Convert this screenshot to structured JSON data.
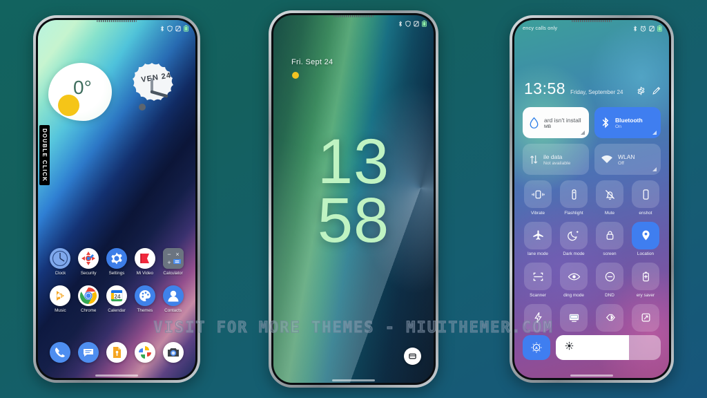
{
  "watermark": {
    "text": "VISIT FOR MORE THEMES - MIUITHEMER.COM"
  },
  "phone1": {
    "badge": "DOUBLE CLICK",
    "statusbar": {
      "icons": [
        "bluetooth-icon",
        "shield-icon",
        "mute-icon",
        "battery-icon"
      ]
    },
    "weather_widget": {
      "temperature": "0°"
    },
    "clock_widget": {
      "label": "VEN 24"
    },
    "apps": [
      {
        "label": "Clock",
        "icon": "clock-icon"
      },
      {
        "label": "Security",
        "icon": "security-icon"
      },
      {
        "label": "Settings",
        "icon": "gear-icon"
      },
      {
        "label": "Mi Video",
        "icon": "video-icon"
      },
      {
        "label": "Calculator",
        "icon": "calculator-icon"
      },
      {
        "label": "Music",
        "icon": "music-icon"
      },
      {
        "label": "Chrome",
        "icon": "chrome-icon"
      },
      {
        "label": "Calendar",
        "icon": "calendar-icon"
      },
      {
        "label": "Themes",
        "icon": "themes-icon"
      },
      {
        "label": "Contacts",
        "icon": "contacts-icon"
      }
    ],
    "dock": [
      {
        "label": "Phone",
        "icon": "phone-icon"
      },
      {
        "label": "Messages",
        "icon": "messages-icon"
      },
      {
        "label": "Files",
        "icon": "files-icon"
      },
      {
        "label": "Photos",
        "icon": "photos-icon"
      },
      {
        "label": "Camera",
        "icon": "camera-icon"
      }
    ]
  },
  "phone2": {
    "statusbar": {
      "icons": [
        "bluetooth-icon",
        "shield-icon",
        "mute-icon",
        "battery-icon"
      ]
    },
    "date": "Fri. Sept  24",
    "clock_hours": "13",
    "clock_minutes": "58",
    "clock_color": "#bff3c2",
    "wallet_button": "wallet-icon"
  },
  "phone3": {
    "carrier": "ency calls only",
    "statusbar": {
      "icons": [
        "bluetooth-icon",
        "alarm-icon",
        "mute-icon",
        "battery-icon"
      ]
    },
    "time": "13:58",
    "date": "Friday, September 24",
    "actions": [
      {
        "name": "settings-gear",
        "icon": "gear-icon"
      },
      {
        "name": "edit-pencil",
        "icon": "pencil-icon"
      }
    ],
    "big_tiles": [
      {
        "title": "ard isn't install",
        "sub": "MB",
        "icon": "water-drop-icon",
        "style": "white"
      },
      {
        "title": "Bluetooth",
        "sub": "On",
        "icon": "bluetooth-icon",
        "style": "blue"
      },
      {
        "title": "ile data",
        "sub": "Not available",
        "icon": "data-arrows-icon",
        "style": "ghost"
      },
      {
        "title": "WLAN",
        "sub": "Off",
        "icon": "wifi-icon",
        "style": "ghost"
      }
    ],
    "quick_settings": [
      {
        "label": "Vibrate",
        "icon": "vibrate-icon",
        "active": false
      },
      {
        "label": "Flashlight",
        "icon": "flashlight-icon",
        "active": false
      },
      {
        "label": "Mute",
        "icon": "bell-off-icon",
        "active": false
      },
      {
        "label": "enshot",
        "icon": "screenshot-icon",
        "active": false
      },
      {
        "label": "lane mode",
        "icon": "airplane-icon",
        "active": false
      },
      {
        "label": "Dark mode",
        "icon": "moon-icon",
        "active": false
      },
      {
        "label": "screen",
        "icon": "lock-icon",
        "active": false
      },
      {
        "label": "Location",
        "icon": "location-pin-icon",
        "active": true
      },
      {
        "label": "Scanner",
        "icon": "scanner-icon",
        "active": false
      },
      {
        "label": "ding mode",
        "icon": "eye-icon",
        "active": false
      },
      {
        "label": "DND",
        "icon": "dnd-icon",
        "active": false
      },
      {
        "label": "ery saver",
        "icon": "battery-saver-icon",
        "active": false
      },
      {
        "label": "",
        "icon": "lightning-icon",
        "active": false
      },
      {
        "label": "",
        "icon": "cast-icon",
        "active": false
      },
      {
        "label": "",
        "icon": "contrast-icon",
        "active": false
      },
      {
        "label": "",
        "icon": "screen-rotate-icon",
        "active": false
      }
    ],
    "brightness": {
      "auto_icon": "auto-brightness-icon",
      "slider_icon": "sun-icon",
      "value_percent": 70
    }
  }
}
